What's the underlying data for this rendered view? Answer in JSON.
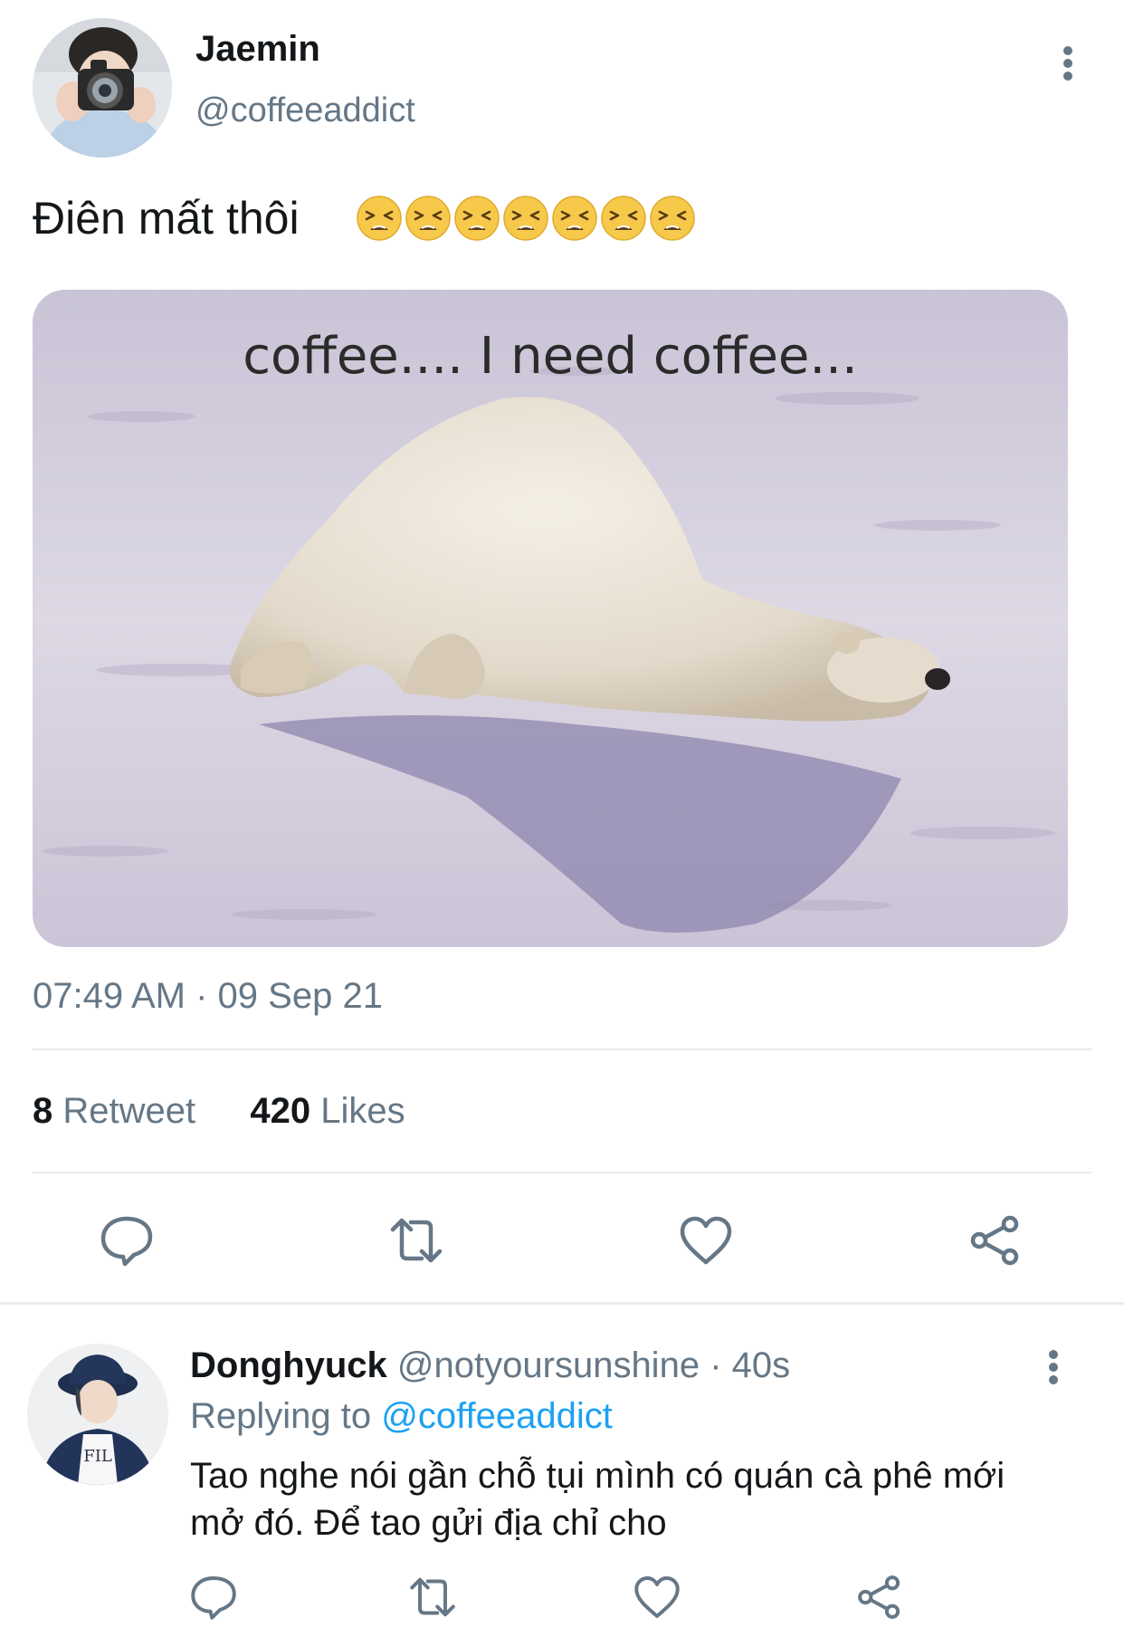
{
  "tweet": {
    "author_name": "Jaemin",
    "author_handle": "@coffeeaddict",
    "text": "Điên mất thôi",
    "emoji_count": 7,
    "emoji_icon": "tired-face-emoji",
    "image_caption": "coffee....  I need coffee...",
    "timestamp": "07:49 AM · 09 Sep 21",
    "retweet_count": "8",
    "retweet_label": "Retweet",
    "like_count": "420",
    "like_label": "Likes",
    "actions": [
      "reply-icon",
      "retweet-icon",
      "like-icon",
      "share-icon"
    ]
  },
  "reply": {
    "author_name": "Donghyuck",
    "author_handle": "@notyoursunshine",
    "time": "· 40s",
    "replying_prefix": "Replying to",
    "replying_to": "@coffeeaddict",
    "text": "Tao nghe nói gần chỗ tụi mình có quán cà phê mới mở đó. Để tao gửi địa chỉ cho",
    "actions": [
      "reply-icon",
      "retweet-icon",
      "like-icon",
      "share-icon"
    ]
  },
  "colors": {
    "text_primary": "#14171a",
    "text_secondary": "#657786",
    "link": "#1da1f2",
    "divider": "#e6ecf0",
    "icon": "#657786"
  }
}
